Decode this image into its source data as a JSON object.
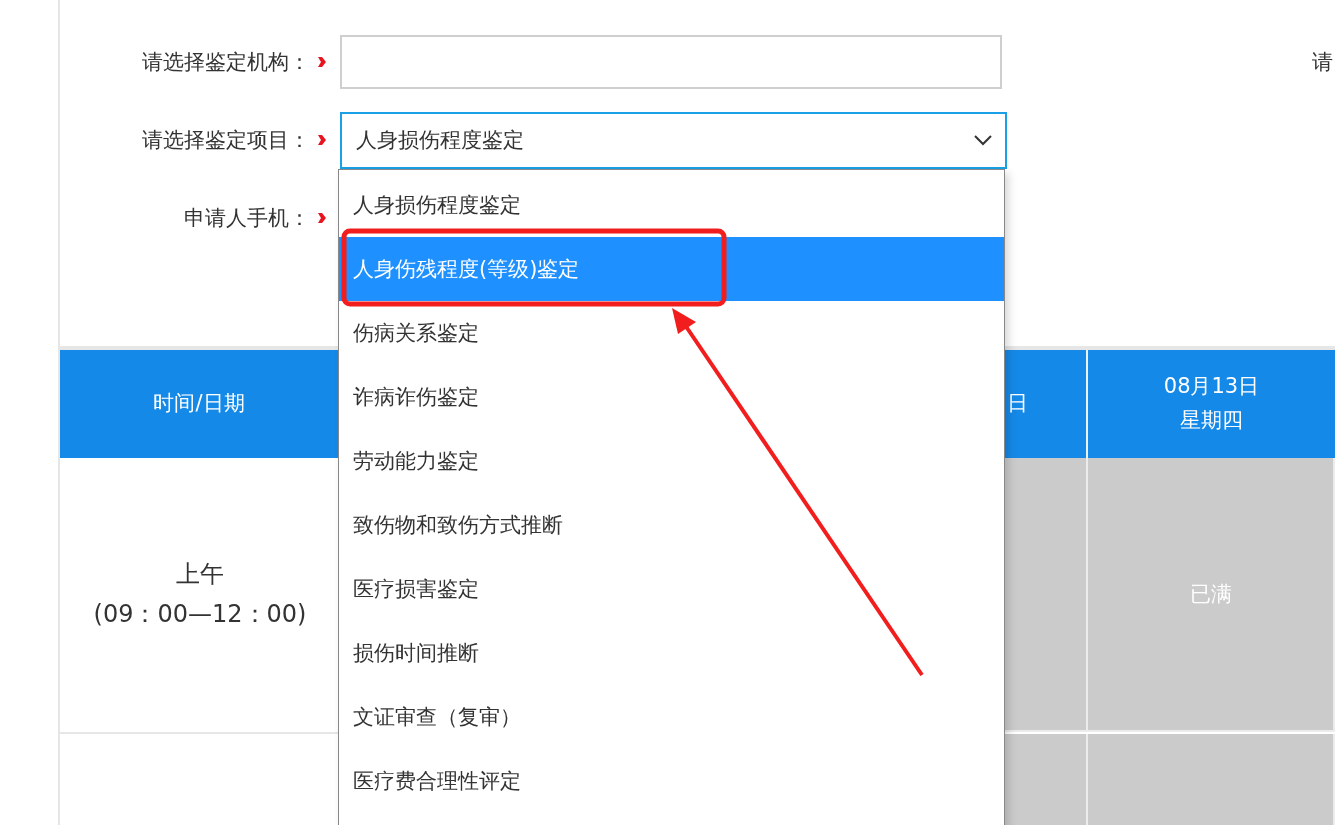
{
  "form": {
    "fields": [
      {
        "label": "请选择鉴定机构：",
        "kind": "input",
        "required": true
      },
      {
        "label": "请选择鉴定项目：",
        "kind": "select",
        "required": true,
        "value": "人身损伤程度鉴定",
        "expanded": true
      },
      {
        "label": "申请人手机：",
        "required": true
      }
    ],
    "side_label": "请"
  },
  "dropdown": {
    "options": [
      {
        "label": "人身损伤程度鉴定",
        "selected": false
      },
      {
        "label": "人身伤残程度(等级)鉴定",
        "selected": true
      },
      {
        "label": "伤病关系鉴定",
        "selected": false
      },
      {
        "label": "诈病诈伤鉴定",
        "selected": false
      },
      {
        "label": "劳动能力鉴定",
        "selected": false
      },
      {
        "label": "致伤物和致伤方式推断",
        "selected": false
      },
      {
        "label": "医疗损害鉴定",
        "selected": false
      },
      {
        "label": "损伤时间推断",
        "selected": false
      },
      {
        "label": "文证审查（复审）",
        "selected": false
      },
      {
        "label": "医疗费合理性评定",
        "selected": false
      }
    ]
  },
  "table": {
    "columns": [
      {
        "label": "时间/日期"
      },
      {
        "label": "日"
      },
      {
        "label": "08月13日",
        "sub": "星期四"
      }
    ],
    "rows": [
      {
        "cells": [
          {
            "kind": "time",
            "label": "上午",
            "time": "(09：00—12：00)"
          },
          {
            "kind": "slot",
            "full": true
          },
          {
            "kind": "slot",
            "text": "已满",
            "full": true
          }
        ]
      },
      {
        "cells": [
          {
            "kind": "time"
          },
          {
            "kind": "slot",
            "full": true
          },
          {
            "kind": "slot",
            "full": true
          }
        ]
      }
    ]
  }
}
